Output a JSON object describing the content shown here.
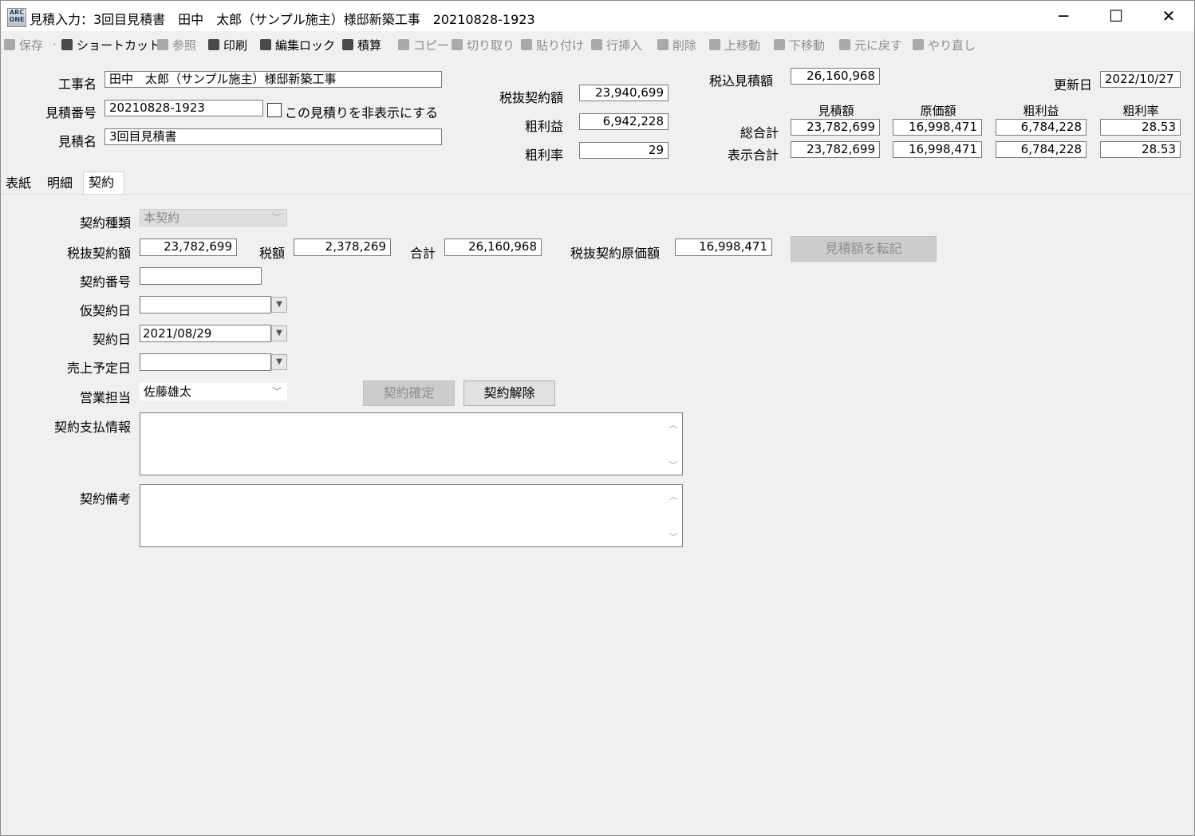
{
  "window": {
    "app_icon": "ARC ONE",
    "title": "見積入力：3回目見積書　田中　太郎（サンプル施主）様邸新築工事　20210828-1923",
    "minimize": "─",
    "maximize": "☐",
    "close": "✕"
  },
  "toolbar": {
    "save": "保存",
    "dot": "·",
    "shortcut": "ショートカット",
    "reference": "参照",
    "print": "印刷",
    "edit_lock": "編集ロック",
    "estimate_calc": "積算",
    "copy": "コピー",
    "cut": "切り取り",
    "paste": "貼り付け",
    "insert_row": "行挿入",
    "delete": "削除",
    "move_up": "上移動",
    "move_down": "下移動",
    "undo": "元に戻す",
    "redo": "やり直し"
  },
  "header": {
    "project_name_label": "工事名",
    "project_name": "田中　太郎（サンプル施主）様邸新築工事",
    "estimate_no_label": "見積番号",
    "estimate_no": "20210828-1923",
    "hide_label": "この見積りを非表示にする",
    "estimate_name_label": "見積名",
    "estimate_name": "3回目見積書",
    "contract_ex_tax_label": "税抜契約額",
    "contract_ex_tax": "23,940,699",
    "gross_profit_label": "粗利益",
    "gross_profit": "6,942,228",
    "gross_rate_label": "粗利率",
    "gross_rate": "29",
    "tax_incl_label": "税込見積額",
    "tax_incl": "26,160,968",
    "updated_label": "更新日",
    "updated": "2022/10/27"
  },
  "summary": {
    "columns": [
      "見積額",
      "原価額",
      "粗利益",
      "粗利率"
    ],
    "rows": [
      {
        "label": "総合計",
        "values": [
          "23,782,699",
          "16,998,471",
          "6,784,228",
          "28.53"
        ]
      },
      {
        "label": "表示合計",
        "values": [
          "23,782,699",
          "16,998,471",
          "6,784,228",
          "28.53"
        ]
      }
    ]
  },
  "tabs": [
    {
      "label": "表紙"
    },
    {
      "label": "明細"
    },
    {
      "label": "契約"
    }
  ],
  "contract": {
    "type_label": "契約種類",
    "type_value": "本契約",
    "amount_ex_tax_label": "税抜契約額",
    "amount_ex_tax": "23,782,699",
    "tax_label": "税額",
    "tax": "2,378,269",
    "total_label": "合計",
    "total": "26,160,968",
    "cost_ex_tax_label": "税抜契約原価額",
    "cost_ex_tax": "16,998,471",
    "transfer_button": "見積額を転記",
    "contract_no_label": "契約番号",
    "contract_no": "",
    "provisional_date_label": "仮契約日",
    "provisional_date": "",
    "contract_date_label": "契約日",
    "contract_date": "2021/08/29",
    "sales_date_label": "売上予定日",
    "sales_date": "",
    "sales_rep_label": "営業担当",
    "sales_rep": "佐藤雄太",
    "confirm_button": "契約確定",
    "cancel_button": "契約解除",
    "payment_info_label": "契約支払情報",
    "payment_info": "",
    "notes_label": "契約備考",
    "notes": ""
  }
}
